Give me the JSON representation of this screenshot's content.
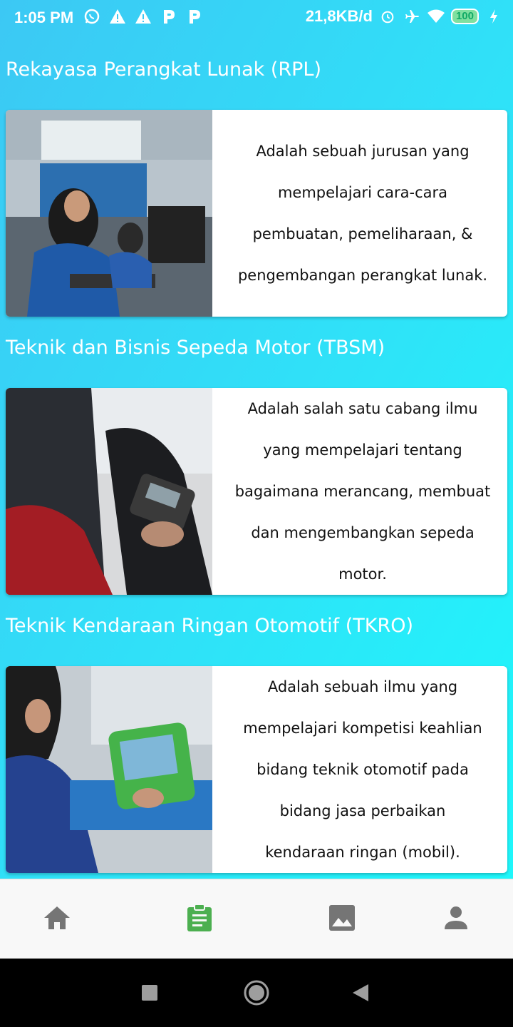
{
  "status_bar": {
    "time": "1:05 PM",
    "network_speed": "21,8KB/d",
    "battery": "100",
    "icons": [
      "whatsapp-icon",
      "warning-icon",
      "warning-icon",
      "p-icon",
      "p-icon",
      "alarm-icon",
      "airplane-icon",
      "wifi-icon",
      "battery-icon",
      "charging-icon"
    ]
  },
  "sections": [
    {
      "title": "Rekayasa Perangkat Lunak (RPL)",
      "lines": [
        "Adalah sebuah jurusan yang",
        "mempelajari cara-cara",
        "pembuatan, pemeliharaan, &",
        "pengembangan perangkat lunak."
      ]
    },
    {
      "title": "Teknik dan Bisnis Sepeda Motor (TBSM)",
      "lines": [
        "Adalah salah satu cabang ilmu",
        "yang mempelajari tentang",
        "bagaimana merancang, membuat",
        "dan mengembangkan sepeda",
        "motor."
      ]
    },
    {
      "title": "Teknik Kendaraan Ringan Otomotif (TKRO)",
      "lines": [
        "Adalah sebuah ilmu yang",
        "mempelajari kompetisi keahlian",
        "bidang teknik otomotif pada",
        "bidang jasa perbaikan",
        "kendaraan ringan (mobil)."
      ]
    }
  ],
  "bottom_nav": {
    "items": [
      "home-icon",
      "clipboard-icon",
      "image-icon",
      "person-icon"
    ],
    "active_color": "#4caf50",
    "inactive_color": "#757575"
  },
  "colors": {
    "gradient_start": "#3cc8f4",
    "gradient_end": "#1ef7fb"
  }
}
